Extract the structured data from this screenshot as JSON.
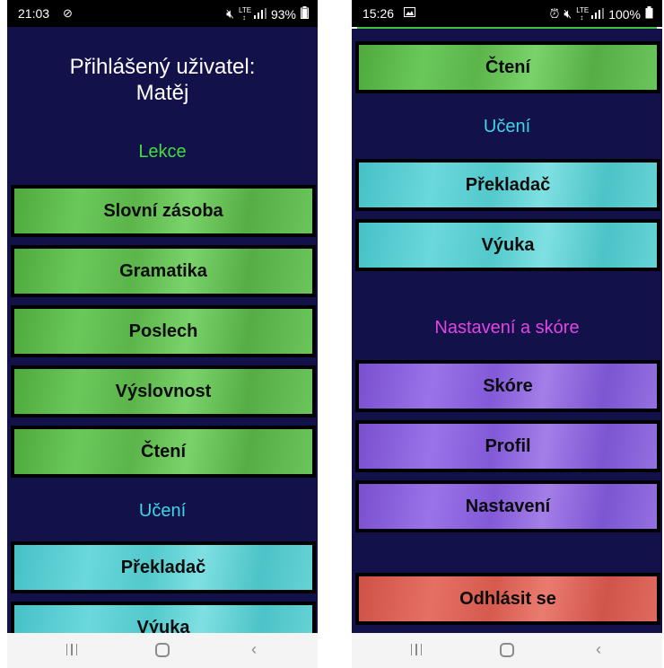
{
  "left": {
    "status": {
      "time": "21:03",
      "battery": "93%"
    },
    "header": {
      "line1": "Přihlášený uživatel:",
      "line2": "Matěj"
    },
    "section_lessons": "Lekce",
    "section_learning": "Učení",
    "buttons": [
      "Slovní zásoba",
      "Gramatika",
      "Poslech",
      "Výslovnost",
      "Čtení",
      "Překladač",
      "Výuka"
    ]
  },
  "right": {
    "status": {
      "time": "15:26",
      "battery": "100%"
    },
    "section_learning": "Učení",
    "section_settings": "Nastavení a skóre",
    "buttons": [
      "Čtení",
      "Překladač",
      "Výuka",
      "Skóre",
      "Profil",
      "Nastavení",
      "Odhlásit se"
    ]
  },
  "colors": {
    "screen_bg": "#13114a",
    "lessons_heading": "#3fe03f",
    "learning_heading": "#3fd6e6",
    "settings_heading": "#e046e0",
    "green_button": "#5bb54a",
    "cyan_button": "#5ccbcf",
    "purple_button": "#8a62dc",
    "red_button": "#d95b50"
  },
  "icons": {
    "status_left": "data-saver-icon",
    "status_right_alarm": "alarm-icon",
    "mute": "mute-icon",
    "signal": "signal-icon",
    "battery": "battery-icon",
    "gallery": "image-icon",
    "nav_recent": "recent-apps-icon",
    "nav_home": "home-icon",
    "nav_back": "back-icon"
  }
}
